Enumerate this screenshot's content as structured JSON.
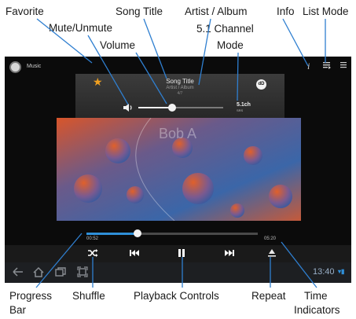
{
  "callouts": {
    "favorite": "Favorite",
    "mute_unmute": "Mute/Unmute",
    "song_title": "Song Title",
    "volume": "Volume",
    "artist_album": "Artist / Album",
    "channel_mode_line1": "5.1 Channel",
    "channel_mode_line2": "Mode",
    "info": "Info",
    "list_mode": "List Mode",
    "progress_bar_line1": "Progress",
    "progress_bar_line2": "Bar",
    "shuffle": "Shuffle",
    "playback_controls": "Playback Controls",
    "repeat": "Repeat",
    "time_indicators_line1": "Time",
    "time_indicators_line2": "Indicators"
  },
  "app": {
    "name": "Music"
  },
  "player": {
    "song_title": "Song Title",
    "artist_album": "Artist / Album",
    "track_count": "4/7",
    "dolby_label": "dD",
    "channel_label": "5.1ch",
    "channel_sub": "SRS",
    "album_overlay": "Bob A",
    "elapsed": "00:52",
    "duration": "05:20",
    "volume_level": 0.4,
    "progress": 0.3
  },
  "navbar": {
    "time": "13:40"
  },
  "icons": {
    "favorite": "star-icon",
    "mute": "speaker-icon",
    "shuffle": "shuffle-icon",
    "previous": "previous-icon",
    "pause": "pause-icon",
    "next": "next-icon",
    "repeat": "repeat-icon",
    "info": "info-icon",
    "list_mode": "list-mode-icon",
    "menu": "menu-icon"
  },
  "colors": {
    "favorite_star": "#f0a020",
    "progress_fill": "#2f8fd8",
    "album_orange": "#e0602a",
    "album_blue": "#3b66a8"
  }
}
